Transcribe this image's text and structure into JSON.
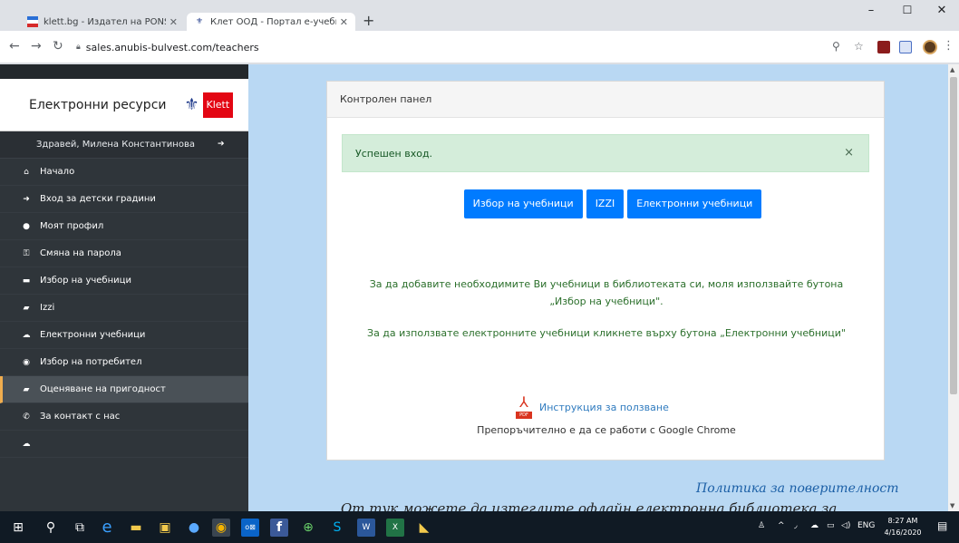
{
  "browser": {
    "tabs": [
      {
        "title": "klett.bg - Издател на PONS речн",
        "favicon": "pons-flag-icon",
        "active": false
      },
      {
        "title": "Клет ООД - Портал е-учебници",
        "favicon": "klett-icon",
        "active": true
      }
    ],
    "new_tab": "+",
    "url": "sales.anubis-bulvest.com/teachers",
    "window_controls": {
      "minimize": "–",
      "maximize": "☐",
      "close": "✕"
    }
  },
  "sidebar": {
    "brand_title": "Електронни ресурси",
    "logo_text": "Klett",
    "greeting": "Здравей, Милена Константинова",
    "menu": [
      {
        "label": "Начало",
        "icon": "home-icon",
        "glyph": "⌂",
        "active": false
      },
      {
        "label": "Вход за детски градини",
        "icon": "sign-in-icon",
        "glyph": "➜",
        "active": false
      },
      {
        "label": "Моят профил",
        "icon": "user-icon",
        "glyph": "●",
        "active": false
      },
      {
        "label": "Смяна на парола",
        "icon": "key-icon",
        "glyph": "⚿",
        "active": false
      },
      {
        "label": "Избор на учебници",
        "icon": "list-icon",
        "glyph": "▬",
        "active": false
      },
      {
        "label": "Izzi",
        "icon": "book-icon",
        "glyph": "▰",
        "active": false
      },
      {
        "label": "Електронни учебници",
        "icon": "cloud-icon",
        "glyph": "☁",
        "active": false
      },
      {
        "label": "Избор на потребител",
        "icon": "user-select-icon",
        "glyph": "◉",
        "active": false
      },
      {
        "label": "Оценяване на пригодност",
        "icon": "book-open-icon",
        "glyph": "▰",
        "active": true
      },
      {
        "label": "За контакт с нас",
        "icon": "phone-icon",
        "glyph": "✆",
        "active": false
      },
      {
        "label": "",
        "icon": "cloud-icon",
        "glyph": "☁",
        "active": false
      }
    ]
  },
  "panel": {
    "header": "Контролен панел",
    "alert": "Успешен вход.",
    "alert_close": "×",
    "buttons": [
      "Избор на учебници",
      "IZZI",
      "Електронни учебници"
    ],
    "info1": "За да добавите необходимите Ви учебници в библиотеката си, моля използвайте бутона „Избор на учебници\".",
    "info2": "За да използвате електронните учебници кликнете върху бутона „Електронни учебници\"",
    "pdf_tag": "PDF",
    "instruction_link": "Инструкция за ползване",
    "chrome_note": "Препоръчително е да се работи с Google Chrome"
  },
  "footer": {
    "privacy": "Политика за поверителност",
    "offline": "От тук можете да изтеглите офлайн електронна библиотека за"
  },
  "taskbar": {
    "lang": "ENG",
    "time": "8:27 AM",
    "date": "4/16/2020"
  },
  "colors": {
    "sidebar_bg": "#2f353a",
    "page_bg": "#b9d8f3",
    "primary": "#007bff",
    "alert_bg": "#d4edda",
    "active_accent": "#f0ad4e",
    "klett_red": "#e30613"
  }
}
